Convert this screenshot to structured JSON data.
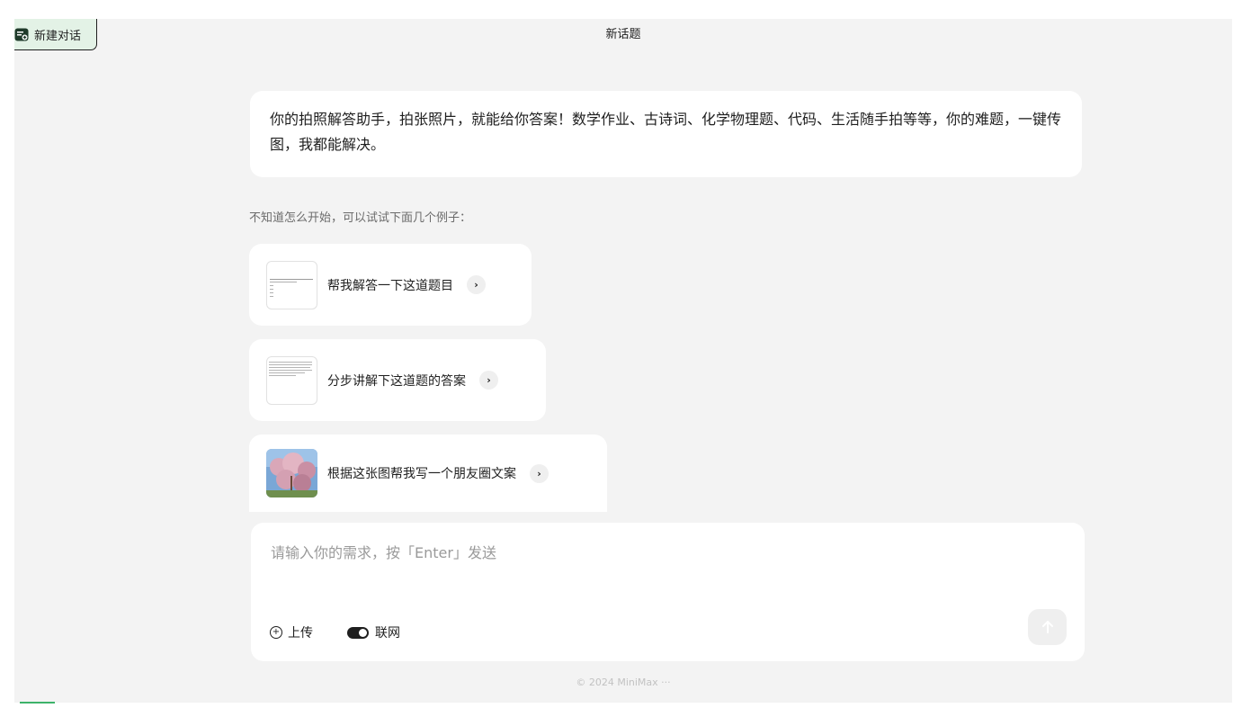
{
  "header": {
    "new_chat_label": "新建对话",
    "topic_title": "新话题"
  },
  "intro": {
    "text": "你的拍照解答助手，拍张照片，就能给你答案！数学作业、古诗词、化学物理题、代码、生活随手拍等等，你的难题，一键传图，我都能解决。"
  },
  "examples": {
    "hint": "不知道怎么开始，可以试试下面几个例子：",
    "items": [
      {
        "label": "帮我解答一下这道题目",
        "thumb": "document-thumbnail",
        "arrow": "›"
      },
      {
        "label": "分步讲解下这道题的答案",
        "thumb": "document-thumbnail",
        "arrow": "›"
      },
      {
        "label": "根据这张图帮我写一个朋友圈文案",
        "thumb": "blossom-photo-thumbnail",
        "arrow": "›"
      }
    ]
  },
  "composer": {
    "placeholder": "请输入你的需求，按「Enter」发送",
    "upload_label": "上传",
    "web_label": "联网",
    "web_enabled": true,
    "send_icon": "arrow-up-icon"
  },
  "footer": {
    "text": "© 2024 MiniMax ···"
  },
  "colors": {
    "accent": "#3db36a",
    "new_chat_bg": "#e3f2e6",
    "app_bg": "#f3f3f3",
    "card_bg": "#ffffff"
  }
}
